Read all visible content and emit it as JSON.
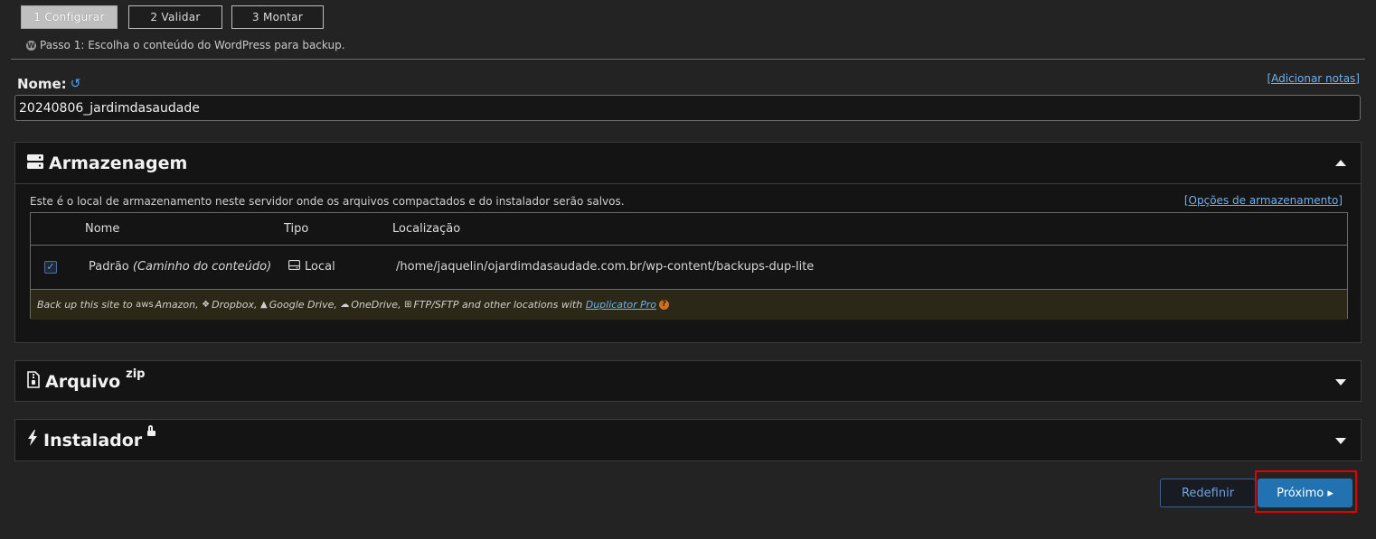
{
  "steps": [
    {
      "label": "1 Configurar",
      "active": true
    },
    {
      "label": "2 Validar",
      "active": false
    },
    {
      "label": "3 Montar",
      "active": false
    }
  ],
  "step_hint": "Passo 1: Escolha o conteúdo do WordPress para backup.",
  "name_section": {
    "label": "Nome:",
    "add_notes_link": "[Adicionar notas]",
    "value": "20240806_jardimdasaudade"
  },
  "storage": {
    "title": "Armazenagem",
    "description": "Este é o local de armazenamento neste servidor onde os arquivos compactados e do instalador serão salvos.",
    "options_link": "[Opções de armazenamento]",
    "columns": [
      "Nome",
      "Tipo",
      "Localização"
    ],
    "rows": [
      {
        "checked": true,
        "name": "Padrão",
        "name_note": "(Caminho do conteúdo)",
        "type": "Local",
        "location": "/home/jaquelin/ojardimdasaudade.com.br/wp-content/backups-dup-lite"
      }
    ],
    "promo": {
      "prefix": "Back up this site to",
      "amazon": "Amazon,",
      "dropbox": "Dropbox,",
      "gdrive": "Google Drive,",
      "onedrive": "OneDrive,",
      "ftp": "FTP/SFTP and other locations with",
      "link": "Duplicator Pro"
    }
  },
  "archive": {
    "title": "Arquivo",
    "sup": "zip"
  },
  "installer": {
    "title": "Instalador"
  },
  "buttons": {
    "reset": "Redefinir",
    "next": "Próximo ▸"
  },
  "colors": {
    "primary": "#2271b1",
    "highlight": "#e00000",
    "link": "#6fb1f0"
  }
}
